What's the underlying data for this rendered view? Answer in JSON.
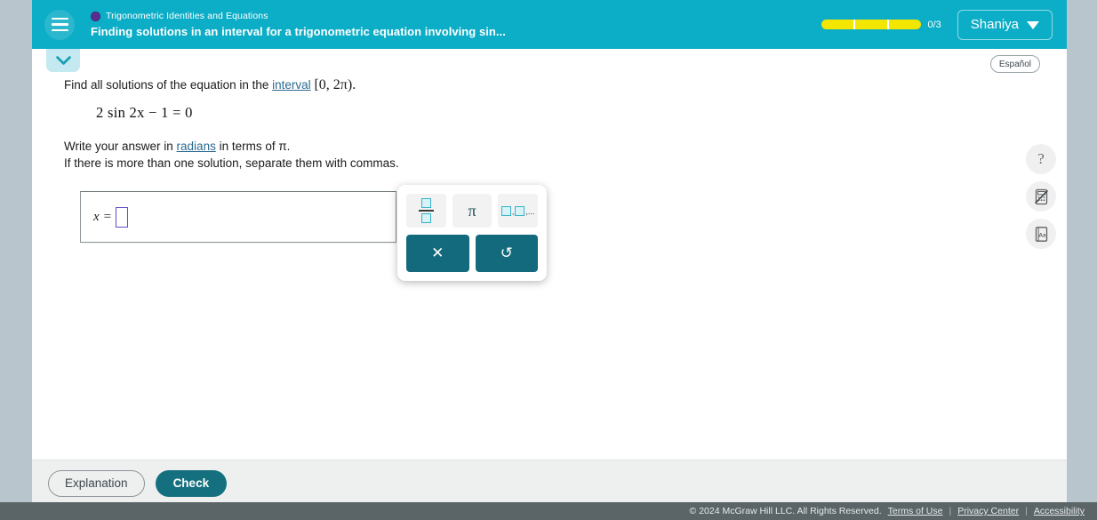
{
  "header": {
    "menu_icon": "hamburger-icon",
    "topic": "Trigonometric Identities and Equations",
    "question_title": "Finding solutions in an interval for a trigonometric equation involving sin...",
    "progress_count": "0/3",
    "progress_segments": 3,
    "progress_color": "#f3e600",
    "user_name": "Shaniya",
    "accent_color": "#0cadc6"
  },
  "toolbar": {
    "collapse_icon": "chevron-down-icon",
    "espanol_label": "Español"
  },
  "question": {
    "prompt_before_link": "Find all solutions of the equation in the ",
    "prompt_link": "interval",
    "prompt_interval": "[0, 2π).",
    "equation": "2 sin 2x − 1 = 0",
    "equation_parts": {
      "coef": "2",
      "func": "sin",
      "arg": "2x",
      "rest": "− 1 = 0"
    },
    "instruction_line1_before": "Write your answer in ",
    "instruction_line1_link": "radians",
    "instruction_line1_after": " in terms of π.",
    "instruction_line2": "If there is more than one solution, separate them with commas."
  },
  "answer": {
    "label": "x",
    "equals": "=",
    "value": "",
    "placeholder_box_color": "#5b4fc4"
  },
  "keypad": {
    "keys": [
      {
        "name": "fraction-key",
        "glyph": "fraction-icon",
        "label": ""
      },
      {
        "name": "pi-key",
        "glyph": "pi-icon",
        "label": "π"
      },
      {
        "name": "comma-list-key",
        "glyph": "list-icon",
        "label": "□,□,..."
      }
    ],
    "actions": [
      {
        "name": "clear-key",
        "glyph": "close-icon",
        "label": "✕"
      },
      {
        "name": "undo-key",
        "glyph": "undo-icon",
        "label": "↺"
      }
    ]
  },
  "rail": {
    "items": [
      {
        "name": "help-button",
        "icon": "question-mark-icon",
        "label": "?"
      },
      {
        "name": "calculator-disabled-button",
        "icon": "calculator-crossed-out-icon",
        "label": ""
      },
      {
        "name": "reference-button",
        "icon": "reference-book-icon",
        "label": "Aa"
      }
    ]
  },
  "actions": {
    "explanation_label": "Explanation",
    "check_label": "Check"
  },
  "footer": {
    "copyright": "© 2024 McGraw Hill LLC. All Rights Reserved.",
    "links": [
      "Terms of Use",
      "Privacy Center",
      "Accessibility"
    ],
    "separator": "|"
  }
}
